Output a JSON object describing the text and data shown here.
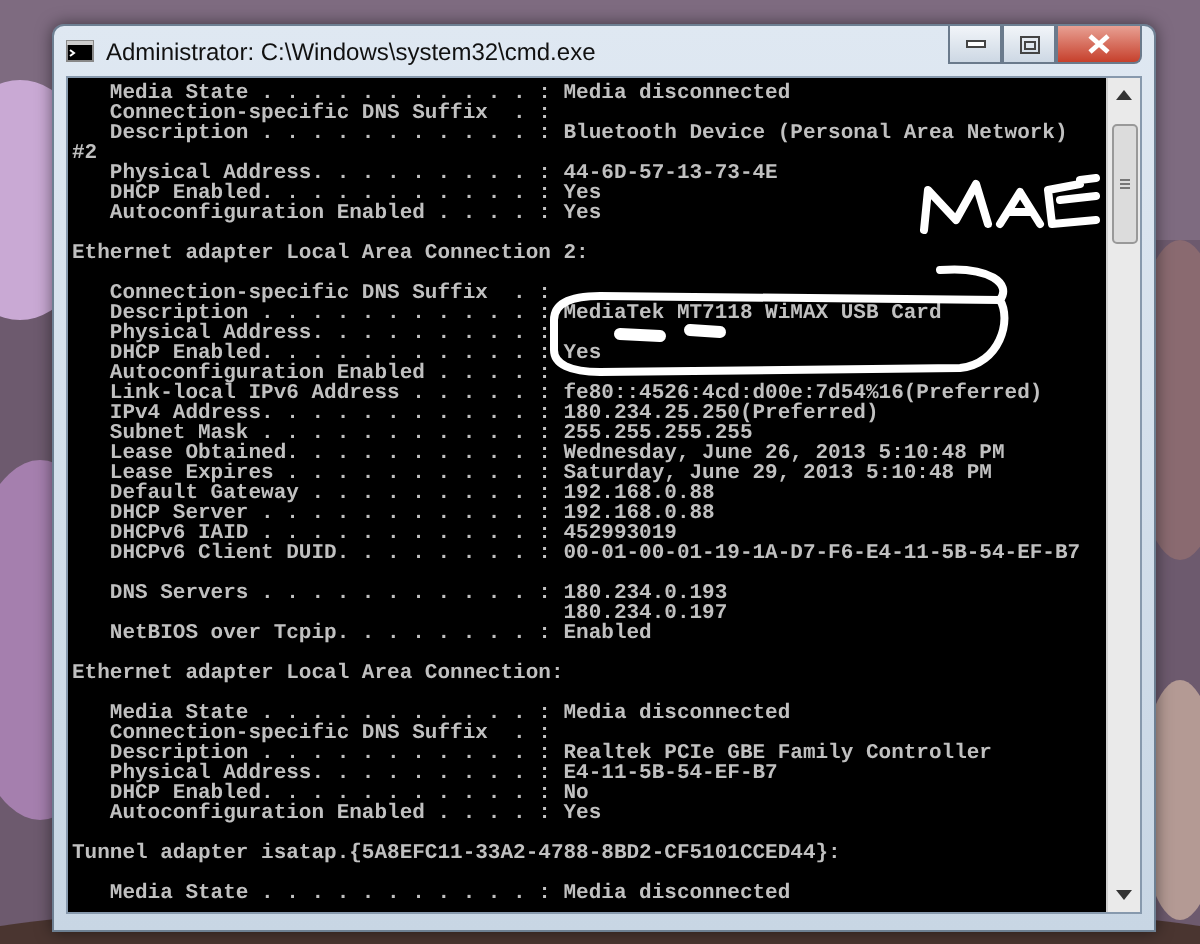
{
  "window": {
    "title": "Administrator: C:\\Windows\\system32\\cmd.exe"
  },
  "console_lines": [
    {
      "kind": "text",
      "text": "   Media State . . . . . . . . . . . : Media disconnected"
    },
    {
      "kind": "text",
      "text": "   Connection-specific DNS Suffix  . :"
    },
    {
      "kind": "text",
      "text": "   Description . . . . . . . . . . . : Bluetooth Device (Personal Area Network)"
    },
    {
      "kind": "text",
      "text": "#2"
    },
    {
      "kind": "text",
      "text": "   Physical Address. . . . . . . . . : 44-6D-57-13-73-4E"
    },
    {
      "kind": "text",
      "text": "   DHCP Enabled. . . . . . . . . . . : Yes"
    },
    {
      "kind": "text",
      "text": "   Autoconfiguration Enabled . . . . : Yes"
    },
    {
      "kind": "blank"
    },
    {
      "kind": "text",
      "text": "Ethernet adapter Local Area Connection 2:"
    },
    {
      "kind": "blank"
    },
    {
      "kind": "text",
      "text": "   Connection-specific DNS Suffix  . :"
    },
    {
      "kind": "text",
      "text": "   Description . . . . . . . . . . . : MediaTek MT7118 WiMAX USB Card"
    },
    {
      "kind": "text",
      "text": "   Physical Address. . . . . . . . . :"
    },
    {
      "kind": "text",
      "text": "   DHCP Enabled. . . . . . . . . . . : Yes"
    },
    {
      "kind": "text",
      "text": "   Autoconfiguration Enabled . . . . :"
    },
    {
      "kind": "text",
      "text": "   Link-local IPv6 Address . . . . . : fe80::4526:4cd:d00e:7d54%16(Preferred)"
    },
    {
      "kind": "text",
      "text": "   IPv4 Address. . . . . . . . . . . : 180.234.25.250(Preferred)"
    },
    {
      "kind": "text",
      "text": "   Subnet Mask . . . . . . . . . . . : 255.255.255.255"
    },
    {
      "kind": "text",
      "text": "   Lease Obtained. . . . . . . . . . : Wednesday, June 26, 2013 5:10:48 PM"
    },
    {
      "kind": "text",
      "text": "   Lease Expires . . . . . . . . . . : Saturday, June 29, 2013 5:10:48 PM"
    },
    {
      "kind": "text",
      "text": "   Default Gateway . . . . . . . . . : 192.168.0.88"
    },
    {
      "kind": "text",
      "text": "   DHCP Server . . . . . . . . . . . : 192.168.0.88"
    },
    {
      "kind": "text",
      "text": "   DHCPv6 IAID . . . . . . . . . . . : 452993019"
    },
    {
      "kind": "text",
      "text": "   DHCPv6 Client DUID. . . . . . . . : 00-01-00-01-19-1A-D7-F6-E4-11-5B-54-EF-B7"
    },
    {
      "kind": "blank"
    },
    {
      "kind": "text",
      "text": "   DNS Servers . . . . . . . . . . . : 180.234.0.193"
    },
    {
      "kind": "text",
      "text": "                                       180.234.0.197"
    },
    {
      "kind": "text",
      "text": "   NetBIOS over Tcpip. . . . . . . . : Enabled"
    },
    {
      "kind": "blank"
    },
    {
      "kind": "text",
      "text": "Ethernet adapter Local Area Connection:"
    },
    {
      "kind": "blank"
    },
    {
      "kind": "text",
      "text": "   Media State . . . . . . . . . . . : Media disconnected"
    },
    {
      "kind": "text",
      "text": "   Connection-specific DNS Suffix  . :"
    },
    {
      "kind": "text",
      "text": "   Description . . . . . . . . . . . : Realtek PCIe GBE Family Controller"
    },
    {
      "kind": "text",
      "text": "   Physical Address. . . . . . . . . : E4-11-5B-54-EF-B7"
    },
    {
      "kind": "text",
      "text": "   DHCP Enabled. . . . . . . . . . . : No"
    },
    {
      "kind": "text",
      "text": "   Autoconfiguration Enabled . . . . : Yes"
    },
    {
      "kind": "blank"
    },
    {
      "kind": "text",
      "text": "Tunnel adapter isatap.{5A8EFC11-33A2-4788-8BD2-CF5101CCED44}:"
    },
    {
      "kind": "blank"
    },
    {
      "kind": "text",
      "text": "   Media State . . . . . . . . . . . : Media disconnected"
    }
  ]
}
